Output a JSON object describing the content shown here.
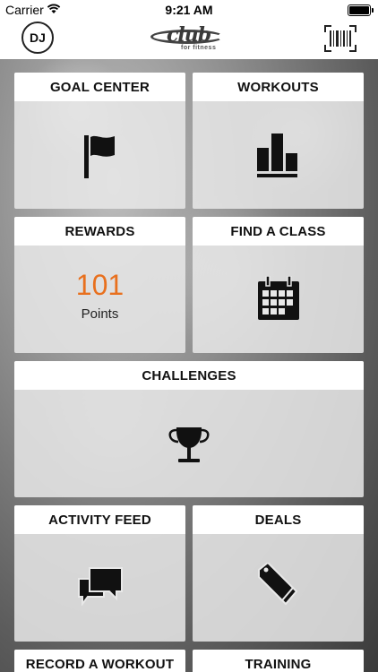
{
  "status_bar": {
    "carrier": "Carrier",
    "time": "9:21 AM"
  },
  "nav": {
    "avatar_initials": "DJ",
    "logo_text": "club",
    "logo_subtext": "for fitness",
    "barcode_icon": "barcode-scan-icon"
  },
  "tiles": {
    "goal_center": {
      "label": "GOAL CENTER",
      "icon": "flag-icon"
    },
    "workouts": {
      "label": "WORKOUTS",
      "icon": "bar-chart-icon"
    },
    "rewards": {
      "label": "REWARDS",
      "points_value": "101",
      "points_label": "Points"
    },
    "find_a_class": {
      "label": "FIND A CLASS",
      "icon": "calendar-icon"
    },
    "challenges": {
      "label": "CHALLENGES",
      "icon": "trophy-icon"
    },
    "activity_feed": {
      "label": "ACTIVITY FEED",
      "icon": "chat-bubbles-icon"
    },
    "deals": {
      "label": "DEALS",
      "icon": "price-tags-icon"
    },
    "record_a_workout": {
      "label": "RECORD A WORKOUT"
    },
    "training": {
      "label": "TRAINING"
    }
  },
  "colors": {
    "accent": "#e8701e",
    "tile_header": "#ffffff",
    "icon": "#111111"
  }
}
